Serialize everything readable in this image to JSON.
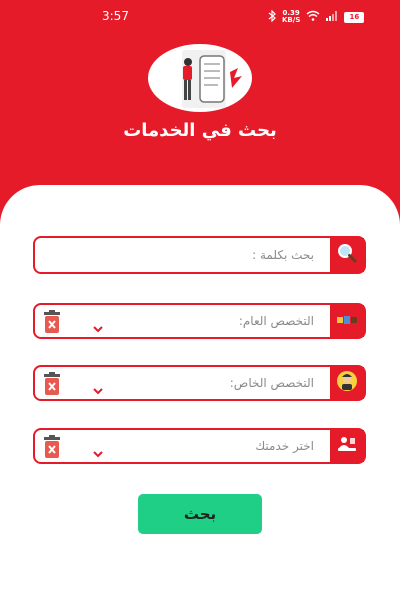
{
  "status_bar": {
    "time": "3:57",
    "net_speed_value": "0.39",
    "net_speed_unit": "KB/S",
    "battery": "16"
  },
  "header": {
    "title": "بحث في الخدمات"
  },
  "form": {
    "keyword_placeholder": "بحث بكلمة :",
    "general_specialty_label": "التخصص العام:",
    "special_specialty_label": "التخصص الخاص:",
    "service_label": "اختر خدمتك",
    "search_button": "بحث"
  },
  "colors": {
    "primary": "#e51b2a",
    "button": "#1ecf85",
    "placeholder_text": "#8a8a8a"
  },
  "icons": [
    "bluetooth-icon",
    "wifi-icon",
    "battery-icon",
    "search-icon",
    "tools-icon",
    "worker-icon",
    "service-icon",
    "trash-icon",
    "chevron-down-icon"
  ]
}
